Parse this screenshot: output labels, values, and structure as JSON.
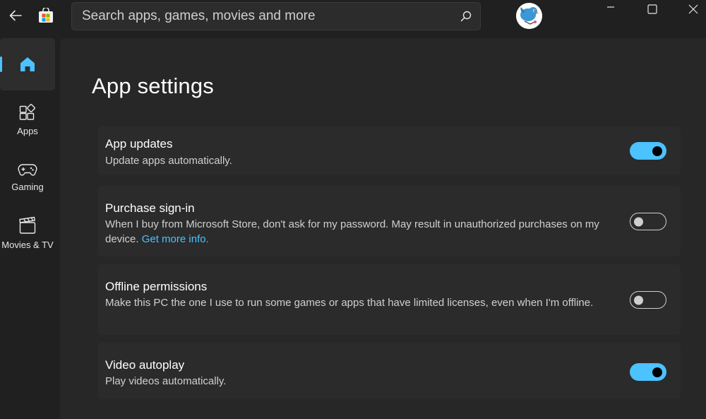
{
  "titlebar": {
    "search_placeholder": "Search apps, games, movies and more"
  },
  "sidebar": {
    "items": [
      {
        "label": "",
        "icon": "home-icon",
        "active": true
      },
      {
        "label": "Apps",
        "icon": "apps-icon",
        "active": false
      },
      {
        "label": "Gaming",
        "icon": "gamepad-icon",
        "active": false
      },
      {
        "label": "Movies & TV",
        "icon": "clapperboard-icon",
        "active": false
      }
    ]
  },
  "main": {
    "title": "App settings",
    "settings": [
      {
        "title": "App updates",
        "description": "Update apps automatically.",
        "enabled": true
      },
      {
        "title": "Purchase sign-in",
        "description": "When I buy from Microsoft Store, don't ask for my password. May result in unauthorized purchases on my device.",
        "link": "Get more info.",
        "enabled": false
      },
      {
        "title": "Offline permissions",
        "description": "Make this PC the one I use to run some games or apps that have limited licenses, even when I'm offline.",
        "enabled": false
      },
      {
        "title": "Video autoplay",
        "description": "Play videos automatically.",
        "enabled": true
      }
    ]
  },
  "colors": {
    "accent": "#4cc2ff",
    "background": "#202020",
    "content": "#272727",
    "card": "#2b2b2b"
  }
}
